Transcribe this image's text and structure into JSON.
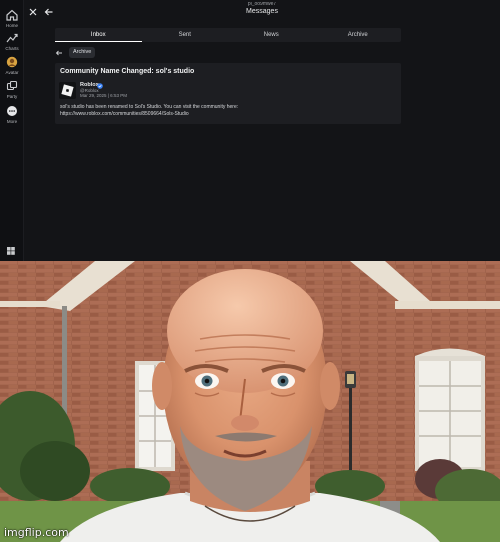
{
  "app": {
    "title_user": "pi_oo9mwe7",
    "title": "Messages",
    "nav": [
      {
        "label": "Home",
        "icon": "home-icon"
      },
      {
        "label": "Charts",
        "icon": "charts-icon"
      },
      {
        "label": "Avatar",
        "icon": "avatar-icon"
      },
      {
        "label": "Party",
        "icon": "party-icon"
      },
      {
        "label": "More",
        "icon": "more-icon"
      }
    ],
    "tabs": [
      {
        "label": "Inbox",
        "active": true
      },
      {
        "label": "Sent",
        "active": false
      },
      {
        "label": "News",
        "active": false
      },
      {
        "label": "Archive",
        "active": false
      }
    ],
    "breadcrumb": {
      "label": "Archive"
    },
    "message": {
      "subject": "Community Name Changed: sol's studio",
      "sender": "Roblox",
      "handle": "@Roblox",
      "date": "Mar 29, 2025 | 6:53 PM",
      "body": "sol's studio has been renamed to Sol's Studio. You can visit the community here:",
      "link": "https://www.roblox.com/communities/8509664/Sols-Studio"
    },
    "colors": {
      "background": "#131417",
      "panel": "#1d1e22",
      "text": "#e6e7e9",
      "verified": "#3b82f6"
    }
  },
  "photo": {
    "watermark": "imgflip.com"
  }
}
